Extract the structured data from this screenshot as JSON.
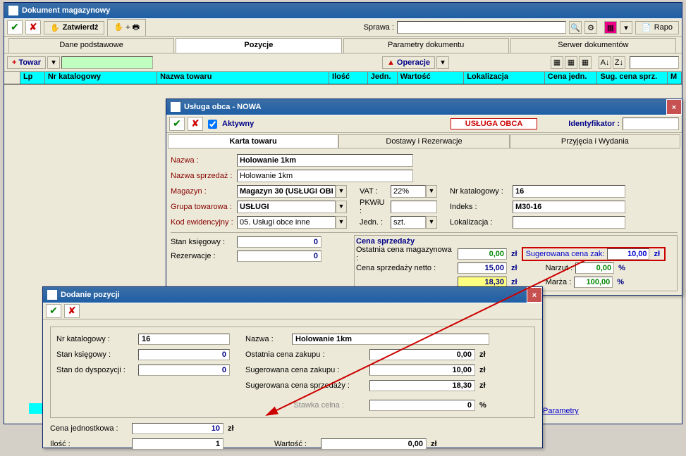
{
  "main": {
    "title": "Dokument magazynowy",
    "toolbar": {
      "zatwierdz": "Zatwierdź",
      "sprawa_label": "Sprawa :",
      "raport": "Rapo"
    },
    "tabs": {
      "t1": "Dane podstawowe",
      "t2": "Pozycje",
      "t3": "Parametry dokumentu",
      "t4": "Serwer dokumentów"
    },
    "toolbar2": {
      "towar": "Towar",
      "operacje": "Operacje"
    },
    "grid": {
      "lp": "Lp",
      "nrkat": "Nr katalogowy",
      "nazwa": "Nazwa towaru",
      "ilosc": "Ilość",
      "jedn": "Jedn.",
      "wartosc": "Wartość",
      "lokal": "Lokalizacja",
      "cenajedn": "Cena jedn.",
      "sugcena": "Sug. cena sprz.",
      "m": "M"
    }
  },
  "sub1": {
    "title": "Usługa obca - NOWA",
    "aktywny": "Aktywny",
    "badge": "USŁUGA OBCA",
    "ident": "Identyfikator :",
    "tabs": {
      "t1": "Karta towaru",
      "t2": "Dostawy i Rezerwacje",
      "t3": "Przyjęcia i Wydania"
    },
    "labels": {
      "nazwa": "Nazwa :",
      "nazwasp": "Nazwa sprzedaż :",
      "magazyn": "Magazyn :",
      "grupa": "Grupa towarowa :",
      "kodew": "Kod ewidencyjny :",
      "vat": "VAT :",
      "pkwiu": "PKWiU :",
      "jedn": "Jedn. :",
      "nrkat": "Nr katalogowy :",
      "indeks": "Indeks :",
      "lokal": "Lokalizacja :"
    },
    "values": {
      "nazwa": "Holowanie 1km",
      "nazwasp": "Holowanie 1km",
      "magazyn": "Magazyn 30 (USŁUGI OBI",
      "grupa": "USŁUGI",
      "kodew": "05. Usługi obce inne",
      "vat": "22%",
      "jedn": "szt.",
      "nrkat": "16",
      "indeks": "M30-16"
    },
    "stat": {
      "stan": "Stan księgowy :",
      "stan_v": "0",
      "rez": "Rezerwacje :",
      "rez_v": "0"
    },
    "price": {
      "title": "Cena sprzedaży",
      "ostatnia": "Ostatnia cena magazynowa :",
      "ostatnia_v": "0,00",
      "sug": "Sugerowana cena zak:",
      "sug_v": "10,00",
      "netto": "Cena sprzedaży netto :",
      "netto_v": "15,00",
      "narzut": "Narzut :",
      "narzut_v": "0,00",
      "brutto_v": "18,30",
      "marza": "Marża :",
      "marza_v": "100,00",
      "zl": "zł",
      "pct": "%"
    }
  },
  "sub2": {
    "title": "Dodanie pozycji",
    "labels": {
      "nrkat": "Nr katalogowy :",
      "nazwa": "Nazwa :",
      "stan": "Stan księgowy :",
      "ostatnia": "Ostatnia cena zakupu :",
      "stando": "Stan do dyspozycji :",
      "sugzak": "Sugerowana cena zakupu :",
      "sugspr": "Sugerowana cena sprzedaży :",
      "stawka": "Stawka celna :",
      "cenajed": "Cena jednostkowa :",
      "ilosc": "Ilość :",
      "wartosc": "Wartość :"
    },
    "values": {
      "nrkat": "16",
      "nazwa": "Holowanie 1km",
      "stan": "0",
      "ostatnia": "0,00",
      "stando": "0",
      "sugzak": "10,00",
      "sugspr": "18,30",
      "stawka": "0",
      "cenajed": "10",
      "ilosc": "1",
      "wartosc": "0,00",
      "zl": "zł",
      "pct": "%"
    }
  },
  "parametry_link": "Parametry"
}
